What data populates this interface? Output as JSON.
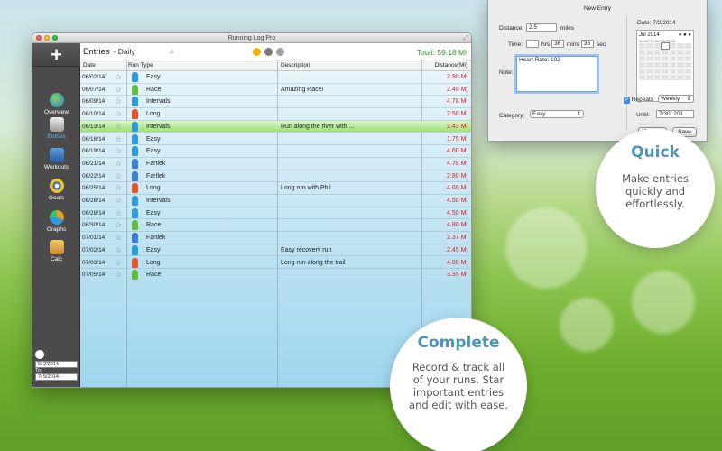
{
  "window": {
    "title": "Running Log Pro"
  },
  "sidebar": {
    "add_label": "+",
    "items": [
      {
        "label": "Overview",
        "icon": "globe-runner-icon"
      },
      {
        "label": "Entries",
        "icon": "runner-icon"
      },
      {
        "label": "Workouts",
        "icon": "weightlifter-icon"
      },
      {
        "label": "Goals",
        "icon": "target-icon"
      },
      {
        "label": "Graphs",
        "icon": "pie-chart-icon"
      },
      {
        "label": "Calc",
        "icon": "calculator-icon"
      }
    ],
    "date_from": "6/ 2/2014",
    "to_label": "To:",
    "date_to": "7/ 5/2014"
  },
  "toolbar": {
    "title": "Entries",
    "subtitle": "- Daily",
    "total": "Total: 59.18 Mi"
  },
  "table": {
    "columns": [
      "Date",
      "Run Type",
      "Description",
      "Distance(Mi)"
    ],
    "rows": [
      {
        "date": "06/02/14",
        "type": "Easy",
        "desc": "",
        "dist": "2.90 Mi"
      },
      {
        "date": "06/07/14",
        "type": "Race",
        "desc": "Amazing Race!",
        "dist": "2.40 Mi"
      },
      {
        "date": "06/09/14",
        "type": "Intervals",
        "desc": "",
        "dist": "4.78 Mi"
      },
      {
        "date": "06/10/14",
        "type": "Long",
        "desc": "",
        "dist": "2.50 Mi"
      },
      {
        "date": "06/13/14",
        "type": "Intervals",
        "desc": "Run along the river with ...",
        "dist": "2.43 Mi",
        "selected": true
      },
      {
        "date": "06/16/14",
        "type": "Easy",
        "desc": "",
        "dist": "1.75 Mi"
      },
      {
        "date": "06/19/14",
        "type": "Easy",
        "desc": "",
        "dist": "4.60 Mi"
      },
      {
        "date": "06/21/14",
        "type": "Fartlek",
        "desc": "",
        "dist": "4.78 Mi"
      },
      {
        "date": "06/22/14",
        "type": "Fartlek",
        "desc": "",
        "dist": "2.80 Mi"
      },
      {
        "date": "06/25/14",
        "type": "Long",
        "desc": "Long run with Phil",
        "dist": "4.60 Mi"
      },
      {
        "date": "06/26/14",
        "type": "Intervals",
        "desc": "",
        "dist": "4.50 Mi"
      },
      {
        "date": "06/28/14",
        "type": "Easy",
        "desc": "",
        "dist": "4.50 Mi"
      },
      {
        "date": "06/30/14",
        "type": "Race",
        "desc": "",
        "dist": "4.80 Mi"
      },
      {
        "date": "07/01/14",
        "type": "Fartlek",
        "desc": "",
        "dist": "2.37 Mi"
      },
      {
        "date": "07/02/14",
        "type": "Easy",
        "desc": "Easy recovery run",
        "dist": "2.45 Mi"
      },
      {
        "date": "07/03/14",
        "type": "Long",
        "desc": "Long run along the trail",
        "dist": "4.80 Mi"
      },
      {
        "date": "07/05/14",
        "type": "Race",
        "desc": "",
        "dist": "3.35 Mi"
      }
    ]
  },
  "dialog": {
    "title": "New Entry",
    "distance_label": "Distance:",
    "distance_value": "2.5",
    "distance_unit": "miles",
    "time_label": "Time:",
    "hrs_value": "",
    "hrs_label": "hrs",
    "mins_value": "36",
    "mins_label": "mins",
    "sec_value": "36",
    "sec_label": "sec",
    "note_label": "Note:",
    "note_value": "Heart Rate: 102",
    "category_label": "Category:",
    "category_value": "Easy",
    "date_label": "Date:",
    "date_value": "7/2/2014",
    "cal_month": "Jul 2014",
    "cal_days": "SU MO TU WE TH FR SA",
    "repeats_label": "Repeats",
    "repeats_value": "Weekly",
    "until_label": "Until:",
    "until_value": "7/30/ 201",
    "cancel": "Cancel",
    "save": "Save"
  },
  "promo": {
    "quick_title": "Quick",
    "quick_text": "Make entries quickly and effortlessly.",
    "complete_title": "Complete",
    "complete_text": "Record & track all of your runs. Star important entries and edit with ease."
  },
  "colors": {
    "total_green": "#2b9b21",
    "distance_red": "#d1232a",
    "accent_blue": "#4e96b4"
  }
}
